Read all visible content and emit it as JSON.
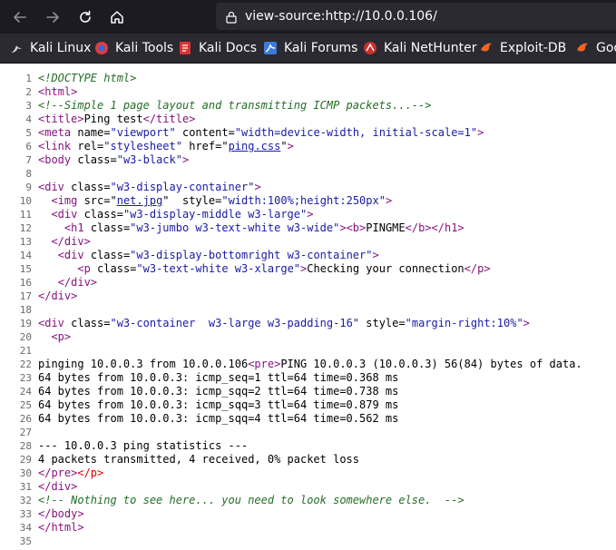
{
  "browser": {
    "url": "view-source:http://10.0.0.106/",
    "colors": {
      "toolbar": "#1c1b22",
      "urlbar": "#2b2a33",
      "text": "#fbfbfe"
    },
    "bookmarks": [
      {
        "label": "Kali Linux",
        "icon": "kali-dragon-icon"
      },
      {
        "label": "Kali Tools",
        "icon": "kali-tools-icon"
      },
      {
        "label": "Kali Docs",
        "icon": "kali-docs-icon"
      },
      {
        "label": "Kali Forums",
        "icon": "kali-forums-icon"
      },
      {
        "label": "Kali NetHunter",
        "icon": "kali-nethunter-icon"
      },
      {
        "label": "Exploit-DB",
        "icon": "exploit-db-icon"
      },
      {
        "label": "Goo",
        "icon": "google-hacking-db-icon"
      }
    ]
  },
  "source": {
    "lines": [
      {
        "n": "1",
        "parts": [
          [
            "dt",
            "<!DOCTYPE html>"
          ]
        ]
      },
      {
        "n": "2",
        "parts": [
          [
            "t",
            "<html>"
          ]
        ]
      },
      {
        "n": "3",
        "parts": [
          [
            "cm",
            "<!--Simple 1 page layout and transmitting ICMP packets...-->"
          ]
        ]
      },
      {
        "n": "4",
        "parts": [
          [
            "t",
            "<title>"
          ],
          [
            "x",
            "Ping test"
          ],
          [
            "t",
            "</title>"
          ]
        ]
      },
      {
        "n": "5",
        "parts": [
          [
            "t",
            "<meta "
          ],
          [
            "an",
            "name"
          ],
          [
            "x",
            "="
          ],
          [
            "av",
            "\"viewport\""
          ],
          [
            "an",
            " content"
          ],
          [
            "x",
            "="
          ],
          [
            "av",
            "\"width=device-width, initial-scale=1\""
          ],
          [
            "t",
            ">"
          ]
        ]
      },
      {
        "n": "6",
        "parts": [
          [
            "t",
            "<link "
          ],
          [
            "an",
            "rel"
          ],
          [
            "x",
            "="
          ],
          [
            "av",
            "\"stylesheet\""
          ],
          [
            "an",
            " href"
          ],
          [
            "x",
            "=\""
          ],
          [
            "lk",
            "ping.css"
          ],
          [
            "x",
            "\""
          ],
          [
            "t",
            ">"
          ]
        ]
      },
      {
        "n": "7",
        "parts": [
          [
            "t",
            "<body "
          ],
          [
            "an",
            "class"
          ],
          [
            "x",
            "="
          ],
          [
            "av",
            "\"w3-black\""
          ],
          [
            "t",
            ">"
          ]
        ]
      },
      {
        "n": "8",
        "parts": []
      },
      {
        "n": "9",
        "parts": [
          [
            "t",
            "<div "
          ],
          [
            "an",
            "class"
          ],
          [
            "x",
            "="
          ],
          [
            "av",
            "\"w3-display-container\""
          ],
          [
            "t",
            ">"
          ]
        ]
      },
      {
        "n": "10",
        "parts": [
          [
            "x",
            "  "
          ],
          [
            "t",
            "<img "
          ],
          [
            "an",
            "src"
          ],
          [
            "x",
            "=\""
          ],
          [
            "lk",
            "net.jpg"
          ],
          [
            "x",
            "\"  "
          ],
          [
            "an",
            "style"
          ],
          [
            "x",
            "="
          ],
          [
            "av",
            "\"width:100%;height:250px\""
          ],
          [
            "t",
            ">"
          ]
        ]
      },
      {
        "n": "11",
        "parts": [
          [
            "x",
            "  "
          ],
          [
            "t",
            "<div "
          ],
          [
            "an",
            "class"
          ],
          [
            "x",
            "="
          ],
          [
            "av",
            "\"w3-display-middle w3-large\""
          ],
          [
            "t",
            ">"
          ]
        ]
      },
      {
        "n": "12",
        "parts": [
          [
            "x",
            "    "
          ],
          [
            "t",
            "<h1 "
          ],
          [
            "an",
            "class"
          ],
          [
            "x",
            "="
          ],
          [
            "av",
            "\"w3-jumbo w3-text-white w3-wide\""
          ],
          [
            "t",
            "><b>"
          ],
          [
            "x",
            "PINGME"
          ],
          [
            "t",
            "</b></h1>"
          ]
        ]
      },
      {
        "n": "13",
        "parts": [
          [
            "x",
            "  "
          ],
          [
            "t",
            "</div>"
          ]
        ]
      },
      {
        "n": "14",
        "parts": [
          [
            "x",
            "   "
          ],
          [
            "t",
            "<div "
          ],
          [
            "an",
            "class"
          ],
          [
            "x",
            "="
          ],
          [
            "av",
            "\"w3-display-bottomright w3-container\""
          ],
          [
            "t",
            ">"
          ]
        ]
      },
      {
        "n": "15",
        "parts": [
          [
            "x",
            "      "
          ],
          [
            "t",
            "<p "
          ],
          [
            "an",
            "class"
          ],
          [
            "x",
            "="
          ],
          [
            "av",
            "\"w3-text-white w3-xlarge\""
          ],
          [
            "t",
            ">"
          ],
          [
            "x",
            "Checking your connection"
          ],
          [
            "t",
            "</p>"
          ]
        ]
      },
      {
        "n": "16",
        "parts": [
          [
            "x",
            "   "
          ],
          [
            "t",
            "</div>"
          ]
        ]
      },
      {
        "n": "17",
        "parts": [
          [
            "t",
            "</div>"
          ]
        ]
      },
      {
        "n": "18",
        "parts": []
      },
      {
        "n": "19",
        "parts": [
          [
            "t",
            "<div "
          ],
          [
            "an",
            "class"
          ],
          [
            "x",
            "="
          ],
          [
            "av",
            "\"w3-container  w3-large w3-padding-16\""
          ],
          [
            "an",
            " style"
          ],
          [
            "x",
            "="
          ],
          [
            "av",
            "\"margin-right:10%\""
          ],
          [
            "t",
            ">"
          ]
        ]
      },
      {
        "n": "20",
        "parts": [
          [
            "x",
            "  "
          ],
          [
            "t",
            "<p>"
          ]
        ]
      },
      {
        "n": "21",
        "parts": []
      },
      {
        "n": "22",
        "parts": [
          [
            "x",
            "pinging 10.0.0.3 from 10.0.0.106"
          ],
          [
            "t",
            "<pre>"
          ],
          [
            "x",
            "PING 10.0.0.3 (10.0.0.3) 56(84) bytes of data."
          ]
        ]
      },
      {
        "n": "23",
        "parts": [
          [
            "x",
            "64 bytes from 10.0.0.3: icmp_seq=1 ttl=64 time=0.368 ms"
          ]
        ]
      },
      {
        "n": "24",
        "parts": [
          [
            "x",
            "64 bytes from 10.0.0.3: icmp_sqq=2 ttl=64 time=0.738 ms"
          ]
        ]
      },
      {
        "n": "25",
        "parts": [
          [
            "x",
            "64 bytes from 10.0.0.3: icmp_sqq=3 ttl=64 time=0.879 ms"
          ]
        ]
      },
      {
        "n": "26",
        "parts": [
          [
            "x",
            "64 bytes from 10.0.0.3: icmp_sqq=4 ttl=64 time=0.562 ms"
          ]
        ]
      },
      {
        "n": "27",
        "parts": []
      },
      {
        "n": "28",
        "parts": [
          [
            "x",
            "--- 10.0.0.3 ping statistics ---"
          ]
        ]
      },
      {
        "n": "29",
        "parts": [
          [
            "x",
            "4 packets transmitted, 4 received, 0% packet loss"
          ]
        ]
      },
      {
        "n": "30",
        "parts": [
          [
            "t",
            "</pre>"
          ],
          [
            "err",
            "</p>"
          ]
        ]
      },
      {
        "n": "31",
        "parts": [
          [
            "t",
            "</div>"
          ]
        ]
      },
      {
        "n": "32",
        "parts": [
          [
            "cm",
            "<!-- Nothing to see here... you need to look somewhere else.  -->"
          ]
        ]
      },
      {
        "n": "33",
        "parts": [
          [
            "t",
            "</body>"
          ]
        ]
      },
      {
        "n": "34",
        "parts": [
          [
            "t",
            "</html>"
          ]
        ]
      },
      {
        "n": "35",
        "parts": []
      }
    ]
  }
}
